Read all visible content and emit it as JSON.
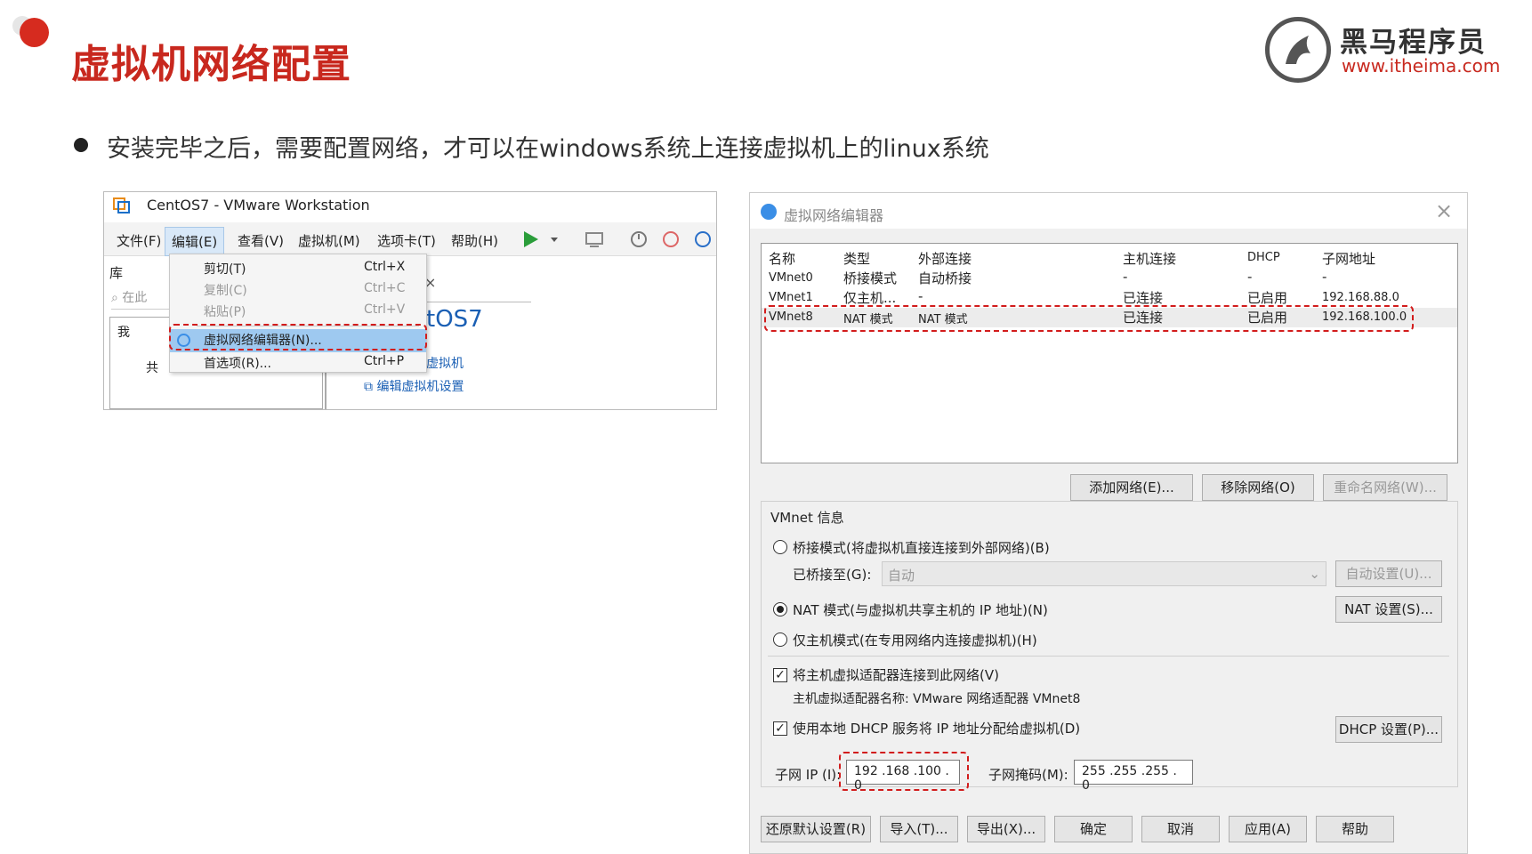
{
  "slide": {
    "title": "虚拟机网络配置",
    "bullet": "安装完毕之后，需要配置网络，才可以在windows系统上连接虚拟机上的linux系统"
  },
  "logo": {
    "name": "黑马程序员",
    "url": "www.itheima.com"
  },
  "vmware": {
    "title": "CentOS7 - VMware Workstation",
    "menu": [
      "文件(F)",
      "编辑(E)",
      "查看(V)",
      "虚拟机(M)",
      "选项卡(T)",
      "帮助(H)"
    ],
    "library_label": "库",
    "search_placeholder": "在此",
    "tree_items": [
      "我",
      "共"
    ],
    "vm_name": "tOS7",
    "link_start": "虚拟机",
    "link_edit": "编辑虚拟机设置",
    "edit_menu": [
      {
        "label": "剪切(T)",
        "shortcut": "Ctrl+X"
      },
      {
        "label": "复制(C)",
        "shortcut": "Ctrl+C"
      },
      {
        "label": "粘贴(P)",
        "shortcut": "Ctrl+V"
      },
      {
        "label": "虚拟网络编辑器(N)...",
        "shortcut": ""
      },
      {
        "label": "首选项(R)...",
        "shortcut": "Ctrl+P"
      }
    ]
  },
  "editor": {
    "title": "虚拟网络编辑器",
    "columns": [
      "名称",
      "类型",
      "外部连接",
      "主机连接",
      "DHCP",
      "子网地址"
    ],
    "rows": [
      [
        "VMnet0",
        "桥接模式",
        "自动桥接",
        "-",
        "-",
        "-"
      ],
      [
        "VMnet1",
        "仅主机...",
        "-",
        "已连接",
        "已启用",
        "192.168.88.0"
      ],
      [
        "VMnet8",
        "NAT 模式",
        "NAT 模式",
        "已连接",
        "已启用",
        "192.168.100.0"
      ]
    ],
    "btn_add": "添加网络(E)...",
    "btn_remove": "移除网络(O)",
    "btn_rename": "重命名网络(W)...",
    "group_label": "VMnet 信息",
    "radio_bridge": "桥接模式(将虚拟机直接连接到外部网络)(B)",
    "bridge_to_label": "已桥接至(G):",
    "bridge_to_value": "自动",
    "btn_auto": "自动设置(U)...",
    "radio_nat": "NAT 模式(与虚拟机共享主机的 IP 地址)(N)",
    "btn_nat": "NAT 设置(S)...",
    "radio_host": "仅主机模式(在专用网络内连接虚拟机)(H)",
    "chk_adapter": "将主机虚拟适配器连接到此网络(V)",
    "adapter_name": "主机虚拟适配器名称: VMware 网络适配器 VMnet8",
    "chk_dhcp": "使用本地 DHCP 服务将 IP 地址分配给虚拟机(D)",
    "btn_dhcp": "DHCP 设置(P)...",
    "subnet_ip_label": "子网 IP (I):",
    "subnet_ip": "192 .168 .100 . 0",
    "subnet_mask_label": "子网掩码(M):",
    "subnet_mask": "255 .255 .255 . 0",
    "footer": [
      "还原默认设置(R)",
      "导入(T)...",
      "导出(X)...",
      "确定",
      "取消",
      "应用(A)",
      "帮助"
    ]
  },
  "colors": {
    "accent": "#c8281e",
    "highlight": "#9ec9f0",
    "link": "#1a5fb4",
    "dashed": "#d21c1c"
  }
}
